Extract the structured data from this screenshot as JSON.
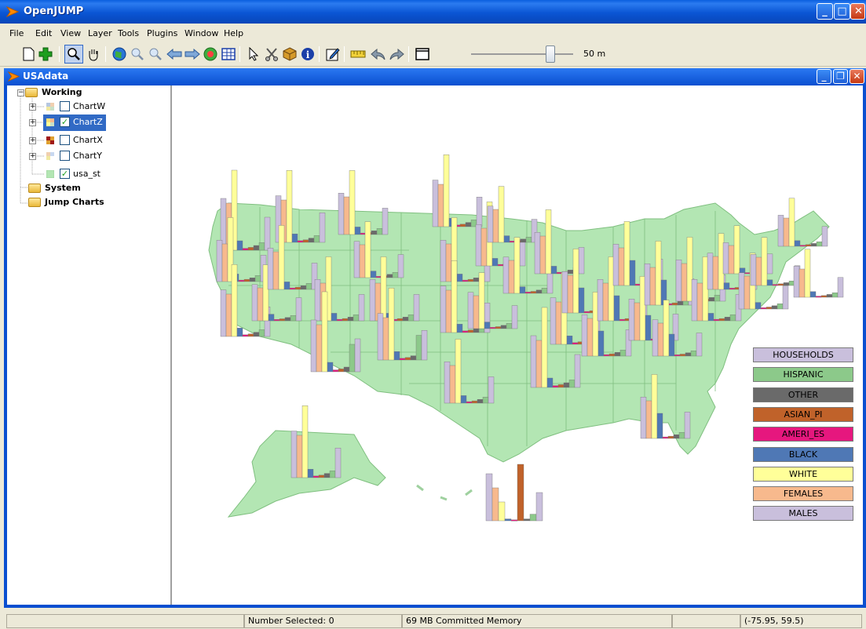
{
  "window": {
    "title": "OpenJUMP"
  },
  "menu": [
    "File",
    "Edit",
    "View",
    "Layer",
    "Tools",
    "Plugins",
    "Window",
    "Help"
  ],
  "toolbar": {
    "scale_label": "50 m"
  },
  "inner_window": {
    "title": "USAdata"
  },
  "tree": {
    "working": "Working",
    "layers": [
      {
        "label": "ChartW",
        "checked": false
      },
      {
        "label": "ChartZ",
        "checked": true,
        "selected": true
      },
      {
        "label": "ChartX",
        "checked": false
      },
      {
        "label": "ChartY",
        "checked": false
      },
      {
        "label": "usa_st",
        "checked": true
      }
    ],
    "system": "System",
    "jump_charts": "Jump Charts"
  },
  "legend": [
    {
      "label": "HOUSEHOLDS",
      "color": "#c9bfdc"
    },
    {
      "label": "HISPANIC",
      "color": "#8cc98a"
    },
    {
      "label": "OTHER",
      "color": "#6a6a6a"
    },
    {
      "label": "ASIAN_PI",
      "color": "#c0622a"
    },
    {
      "label": "AMERI_ES",
      "color": "#e6177e"
    },
    {
      "label": "BLACK",
      "color": "#4f78b5"
    },
    {
      "label": "WHITE",
      "color": "#ffff99"
    },
    {
      "label": "FEMALES",
      "color": "#f7b98d"
    },
    {
      "label": "MALES",
      "color": "#c9bfdc"
    }
  ],
  "colors": {
    "land": "#b3e6b3",
    "land_stroke": "#7fbf7f"
  },
  "status": {
    "selected": "Number Selected: 0",
    "memory": "69 MB Committed Memory",
    "coords": "(-75.95, 59.5)"
  }
}
